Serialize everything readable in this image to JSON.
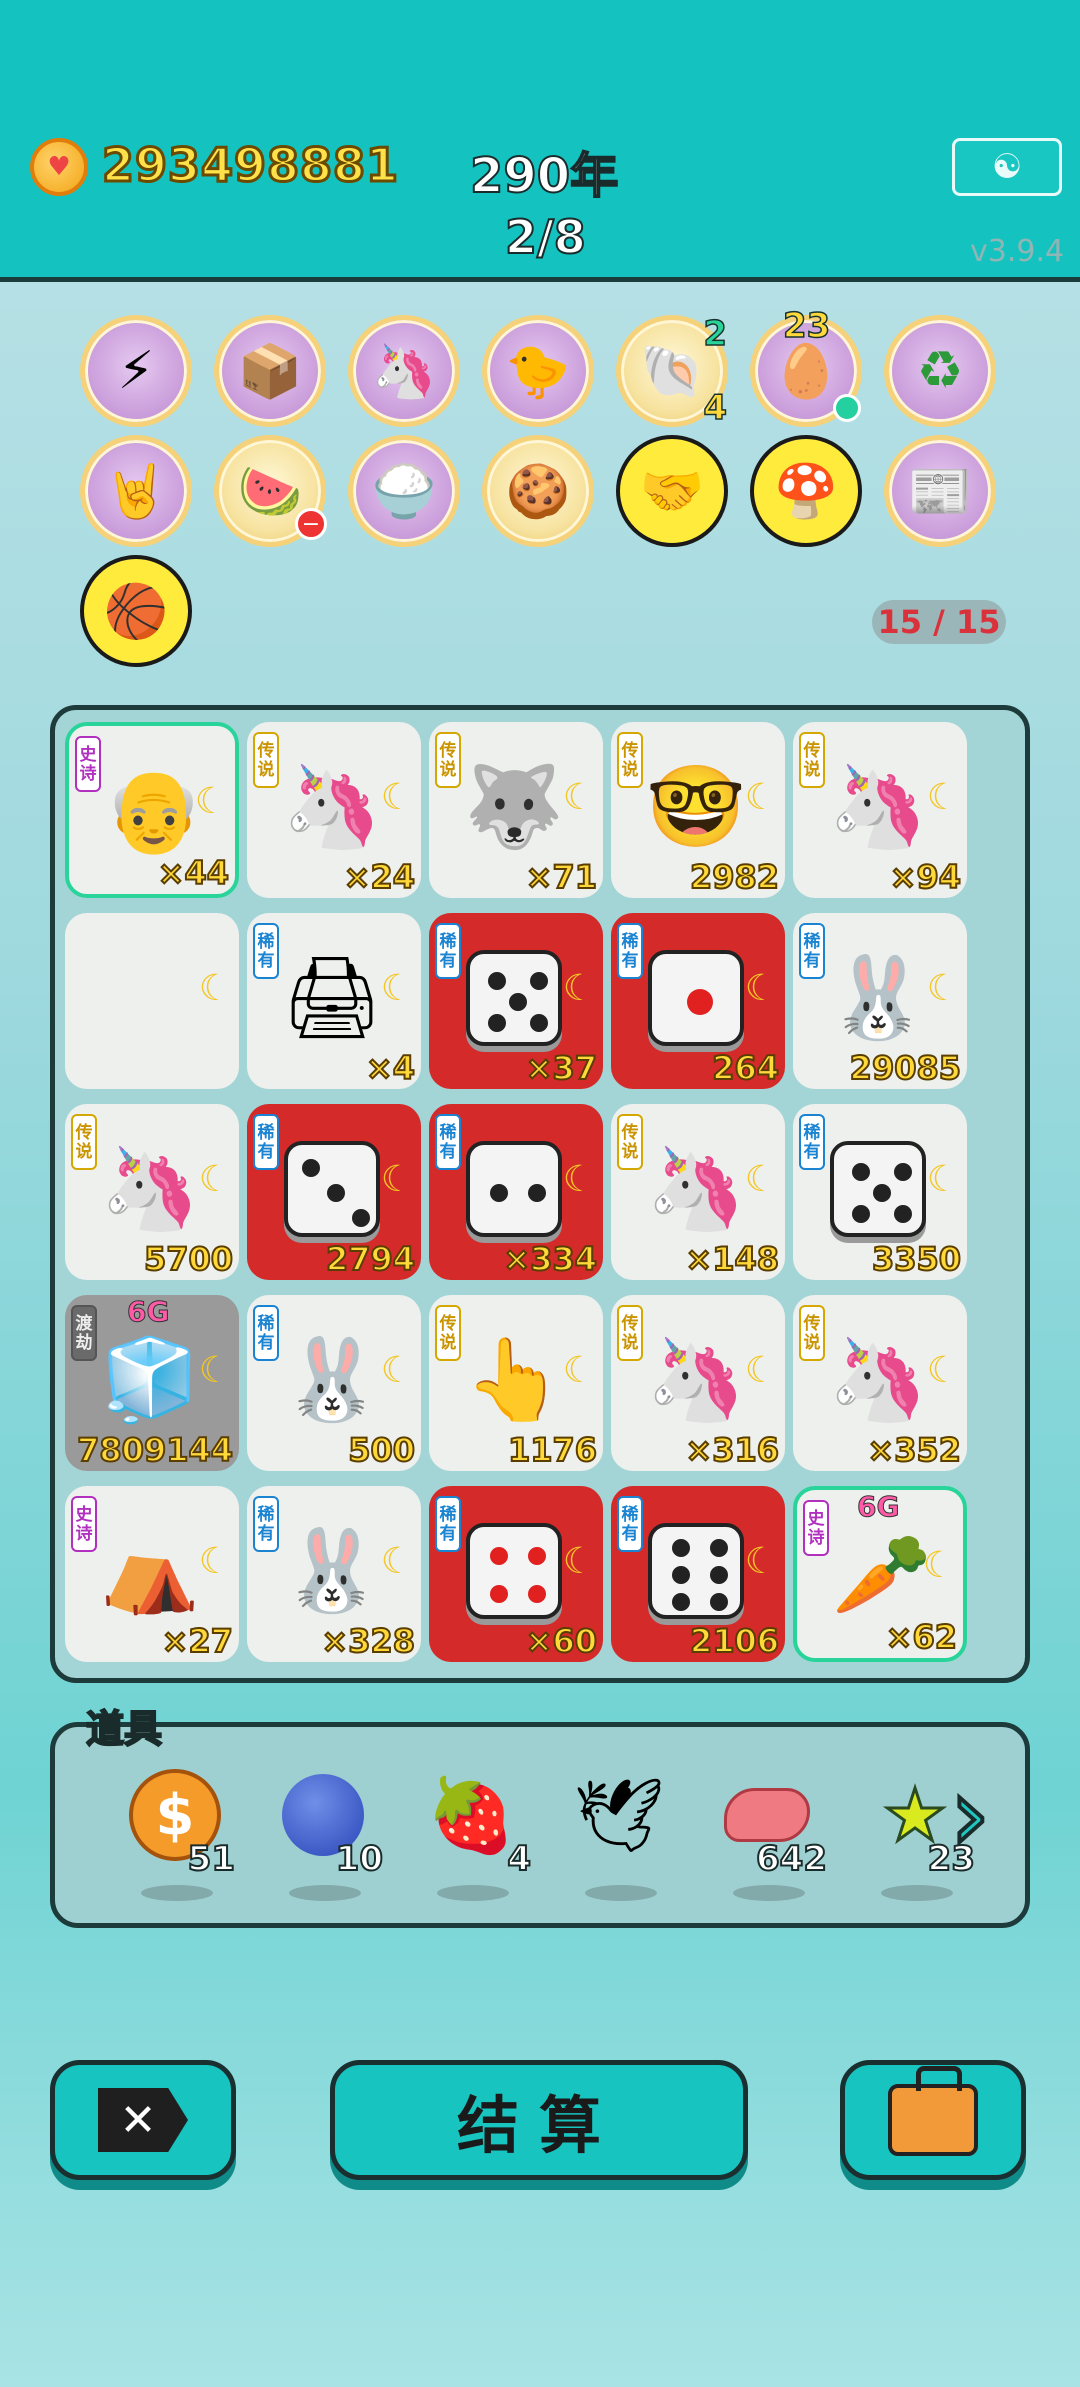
{
  "header": {
    "coins": "293498881",
    "year": "290年",
    "round": "2/8",
    "version": "v3.9.4",
    "meditate_icon": "meditation-person-icon"
  },
  "relics": [
    {
      "icon": "lightning-icon",
      "style": "purple"
    },
    {
      "icon": "tissue-box-icon",
      "style": "purple"
    },
    {
      "icon": "unicorn-icon",
      "style": "purple"
    },
    {
      "icon": "chick-icon",
      "style": "purple"
    },
    {
      "icon": "shell-icon",
      "style": "gold",
      "badge_top": "2",
      "badge_bottom": "4"
    },
    {
      "icon": "egg-tray-icon",
      "style": "purple",
      "badge_top": "23"
    },
    {
      "icon": "recycle-icon",
      "style": "purple"
    },
    {
      "icon": "rock-hand-icon",
      "style": "purple"
    },
    {
      "icon": "fruit-basket-icon",
      "style": "gold"
    },
    {
      "icon": "bowls-icon",
      "style": "purple"
    },
    {
      "icon": "biscuit-icon",
      "style": "gold"
    },
    {
      "icon": "handshake-icon",
      "style": "yellow"
    },
    {
      "icon": "mushroom-cloud-icon",
      "style": "yellow"
    },
    {
      "icon": "time-magazine-icon",
      "style": "purple"
    },
    {
      "icon": "basketballs-icon",
      "style": "yellow"
    }
  ],
  "relic_count": "15 / 15",
  "board": [
    {
      "icon": "old-man-icon",
      "tag": "史诗",
      "rarity": "epic",
      "value": "×44",
      "bg": "normal",
      "highlight": true
    },
    {
      "icon": "unicorn-icon",
      "tag": "传说",
      "rarity": "legend",
      "value": "×24",
      "bg": "normal"
    },
    {
      "icon": "husky-king-icon",
      "tag": "传说",
      "rarity": "legend",
      "value": "×71",
      "bg": "normal"
    },
    {
      "icon": "glasses-man-icon",
      "tag": "传说",
      "rarity": "legend",
      "value": "2982",
      "bg": "normal"
    },
    {
      "icon": "unicorn-icon",
      "tag": "传说",
      "rarity": "legend",
      "value": "×94",
      "bg": "normal"
    },
    {
      "icon": "",
      "tag": "",
      "rarity": "",
      "value": "",
      "bg": "normal"
    },
    {
      "icon": "printer-icon",
      "tag": "稀有",
      "rarity": "rare",
      "value": "×4",
      "bg": "normal"
    },
    {
      "icon": "die-5-icon",
      "tag": "稀有",
      "rarity": "rare",
      "value": "×37",
      "bg": "red",
      "die": 5
    },
    {
      "icon": "die-1-icon",
      "tag": "稀有",
      "rarity": "rare",
      "value": "264",
      "bg": "red",
      "die": 1
    },
    {
      "icon": "rabbit-icon",
      "tag": "稀有",
      "rarity": "rare",
      "value": "29085",
      "bg": "normal"
    },
    {
      "icon": "unicorn-icon",
      "tag": "传说",
      "rarity": "legend",
      "value": "5700",
      "bg": "normal"
    },
    {
      "icon": "die-3-icon",
      "tag": "稀有",
      "rarity": "rare",
      "value": "2794",
      "bg": "red",
      "die": 3
    },
    {
      "icon": "die-2-icon",
      "tag": "稀有",
      "rarity": "rare",
      "value": "×334",
      "bg": "red",
      "die": 2
    },
    {
      "icon": "unicorn-icon",
      "tag": "传说",
      "rarity": "legend",
      "value": "×148",
      "bg": "normal"
    },
    {
      "icon": "die-5-icon",
      "tag": "稀有",
      "rarity": "rare",
      "value": "3350",
      "bg": "normal",
      "die": 5
    },
    {
      "icon": "fridge-icon",
      "tag": "渡劫",
      "rarity": "grey",
      "value": "7809144",
      "bg": "grey",
      "sixg": "6G"
    },
    {
      "icon": "rabbit-icon",
      "tag": "稀有",
      "rarity": "rare",
      "value": "500",
      "bg": "normal"
    },
    {
      "icon": "pointing-hand-icon",
      "tag": "传说",
      "rarity": "legend",
      "value": "1176",
      "bg": "normal"
    },
    {
      "icon": "unicorn-icon",
      "tag": "传说",
      "rarity": "legend",
      "value": "×316",
      "bg": "normal"
    },
    {
      "icon": "unicorn-icon",
      "tag": "传说",
      "rarity": "legend",
      "value": "×352",
      "bg": "normal"
    },
    {
      "icon": "rabbit-hut-icon",
      "tag": "史诗",
      "rarity": "epic",
      "value": "×27",
      "bg": "normal"
    },
    {
      "icon": "rabbit-icon",
      "tag": "稀有",
      "rarity": "rare",
      "value": "×328",
      "bg": "normal"
    },
    {
      "icon": "die-4-red-icon",
      "tag": "稀有",
      "rarity": "rare",
      "value": "×60",
      "bg": "red",
      "die": 4
    },
    {
      "icon": "die-6-icon",
      "tag": "稀有",
      "rarity": "rare",
      "value": "2106",
      "bg": "red",
      "die": 6
    },
    {
      "icon": "carrot-icon",
      "tag": "史诗",
      "rarity": "epic",
      "value": "×62",
      "bg": "normal",
      "highlight": true,
      "sixg": "6G"
    }
  ],
  "items": {
    "label": "道具",
    "list": [
      {
        "icon": "dollar-coin-icon",
        "count": "51"
      },
      {
        "icon": "blueberry-icon",
        "count": "10"
      },
      {
        "icon": "strawberry-icon",
        "count": "4"
      },
      {
        "icon": "white-bird-icon",
        "count": ""
      },
      {
        "icon": "liver-icon",
        "count": "642"
      },
      {
        "icon": "star-icon",
        "count": "23"
      }
    ],
    "next_icon": "chevron-right-icon"
  },
  "buttons": {
    "exit_icon": "exit-x-icon",
    "settle_label": "结算",
    "bag_icon": "briefcase-icon"
  }
}
